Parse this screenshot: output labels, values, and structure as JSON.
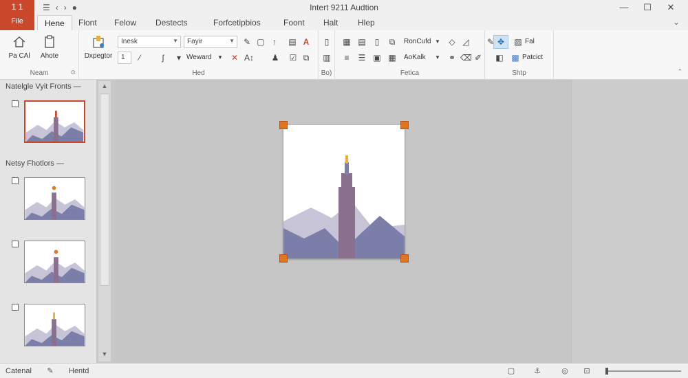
{
  "app": {
    "badge_label": "1 1",
    "file_tab": "File",
    "window_title": "Intert 9211 Audtion"
  },
  "quick_access": {
    "icons": [
      "menu-icon",
      "undo-icon",
      "redo-icon",
      "circle-icon"
    ]
  },
  "window_controls": {
    "minimize": "—",
    "maximize": "☐",
    "close": "✕"
  },
  "tabs": [
    "Hene",
    "Flont",
    "Felow",
    "Destects",
    "Forfcetipbios",
    "Foont",
    "Halt",
    "Hlep"
  ],
  "ribbon": {
    "group1": {
      "btn1": "Pa CAl",
      "btn2": "Ahote",
      "label": "Neam"
    },
    "group2": {
      "big_btn": "Dxpegtor",
      "font_name": "Inesk",
      "font_size": "Fayir",
      "num_field": "1",
      "weward": "Weward",
      "label": "Hed"
    },
    "group3": {
      "label": "Bo)"
    },
    "group4": {
      "item1": "RonCufd",
      "item2": "AoKalk",
      "label": "Fetica"
    },
    "group5": {
      "item1": "Fal",
      "item2": "Patcict",
      "label": "Shtp"
    }
  },
  "panel": {
    "section1": "Natelgle Vyit Fronts",
    "section2": "Netsy Fhotlors",
    "more": "—"
  },
  "status": {
    "left": "Catenal",
    "middle": "Hentd"
  },
  "colors": {
    "accent": "#c9472a",
    "handle": "#e0751f",
    "mountain_light": "#c8c4d8",
    "mountain_dark": "#7b7ea8",
    "tower": "#8a6f8e"
  }
}
